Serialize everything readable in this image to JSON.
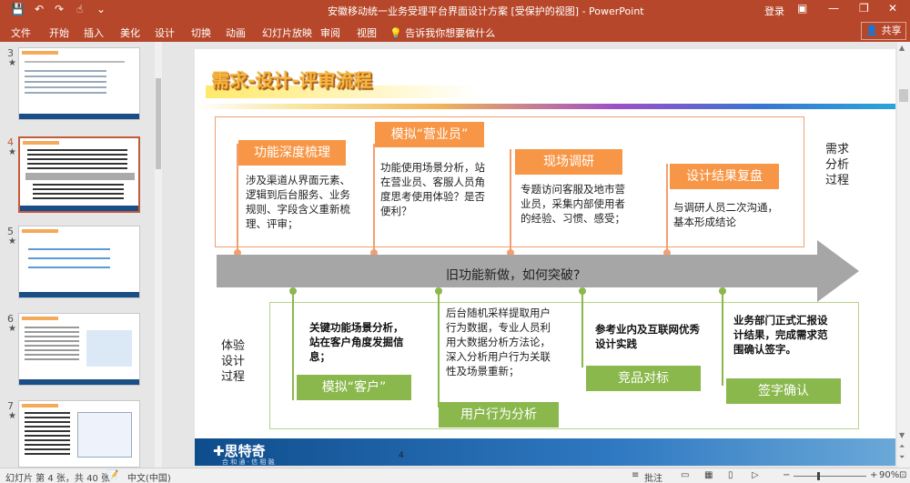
{
  "titlebar": {
    "title": "安徽移动统一业务受理平台界面设计方案 [受保护的视图] - PowerPoint",
    "login": "登录",
    "save_icon": "💾",
    "undo_icon": "↶",
    "redo_icon": "↷",
    "touch_icon": "☝",
    "customize_icon": "⌄",
    "ribbon_display_icon": "▣",
    "minimize": "—",
    "maximize": "❐",
    "close": "✕"
  },
  "ribbon": {
    "tabs": [
      "文件",
      "开始",
      "插入",
      "美化",
      "设计",
      "切换",
      "动画",
      "幻灯片放映",
      "审阅",
      "视图"
    ],
    "tell_icon": "💡",
    "tell": "告诉我你想要做什么",
    "share_icon": "👤",
    "share": "共享"
  },
  "thumbnails": [
    {
      "num": "3",
      "star": "★"
    },
    {
      "num": "4",
      "star": "★"
    },
    {
      "num": "5",
      "star": "★"
    },
    {
      "num": "6",
      "star": "★"
    },
    {
      "num": "7",
      "star": "★"
    }
  ],
  "slide": {
    "title": "需求-设计-评审流程",
    "top_steps": [
      {
        "label": "功能深度梳理",
        "text": "涉及渠道从界面元素、逻辑到后台服务、业务规则、字段含义重新梳理、评审；"
      },
      {
        "label": "模拟“营业员”",
        "text": "功能使用场景分析，站在营业员、客服人员角度思考使用体验？是否便利？"
      },
      {
        "label": "现场调研",
        "text": "专题访问客服及地市营业员，采集内部使用者的经验、习惯、感受；"
      },
      {
        "label": "设计结果复盘",
        "text": "与调研人员二次沟通，基本形成结论"
      }
    ],
    "side_top": "需求\n分析\n过程",
    "arrow_text": "旧功能新做，如何突破?",
    "side_bottom": "体验\n设计\n过程",
    "bottom_steps": [
      {
        "label": "模拟“客户”",
        "text": "关键功能场景分析，站在客户角度发掘信息；"
      },
      {
        "label": "用户行为分析",
        "text": "后台随机采样提取用户行为数据，专业人员利用大数据分析方法论，深入分析用户行为关联性及场景重新；"
      },
      {
        "label": "竞品对标",
        "text": "参考业内及互联网优秀设计实践"
      },
      {
        "label": "签字确认",
        "text": "业务部门正式汇报设计结果，完成需求范围确认签字。"
      }
    ],
    "footer_logo": "✚思特奇",
    "footer_sub": "合 和 通 · 信 相 融",
    "page_number": "4"
  },
  "statusbar": {
    "slide_info": "幻灯片 第 4 张，共 40 张",
    "proof_icon": "📝",
    "language": "中文(中国)",
    "notes_icon": "≡",
    "notes": "批注",
    "view_normal": "▭",
    "view_sorter": "▦",
    "view_reading": "▯",
    "view_show": "▷",
    "zoom_minus": "−",
    "zoom_plus": "+",
    "zoom": "90%",
    "fit_icon": "⊡"
  }
}
